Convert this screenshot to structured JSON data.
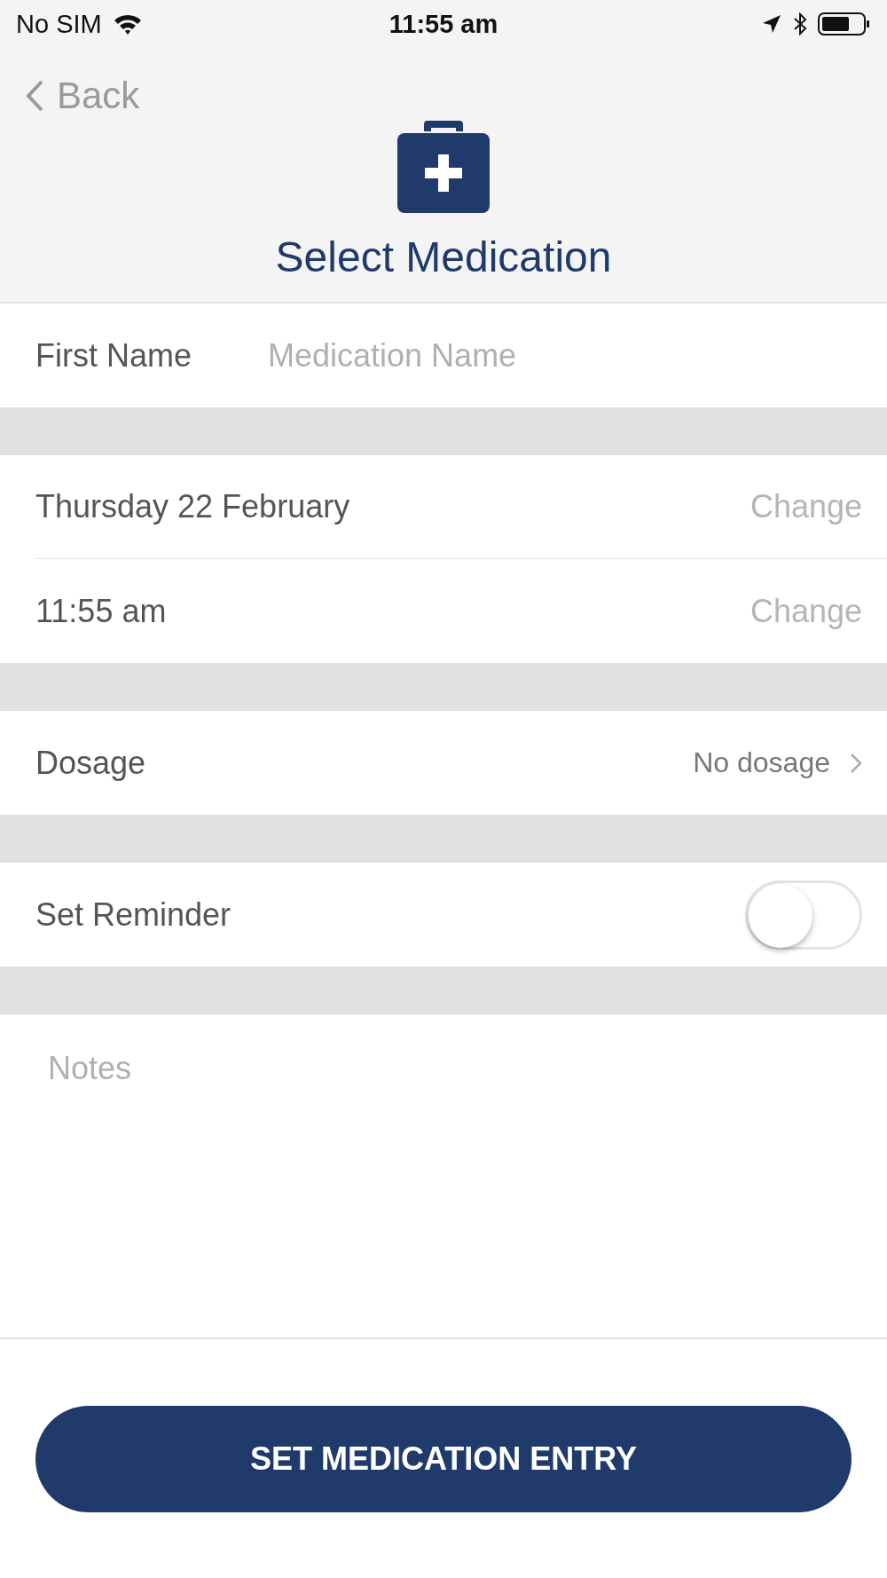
{
  "status_bar": {
    "carrier": "No SIM",
    "time": "11:55 am"
  },
  "nav": {
    "back": "Back",
    "title": "Select Medication"
  },
  "name_row": {
    "label": "First Name",
    "placeholder": "Medication Name"
  },
  "datetime_rows": [
    {
      "value": "Thursday 22 February",
      "action": "Change"
    },
    {
      "value": "11:55 am",
      "action": "Change"
    }
  ],
  "dosage": {
    "label": "Dosage",
    "value": "No dosage"
  },
  "reminder": {
    "label": "Set Reminder",
    "on": false
  },
  "notes": {
    "placeholder": "Notes"
  },
  "submit": "SET MEDICATION ENTRY"
}
